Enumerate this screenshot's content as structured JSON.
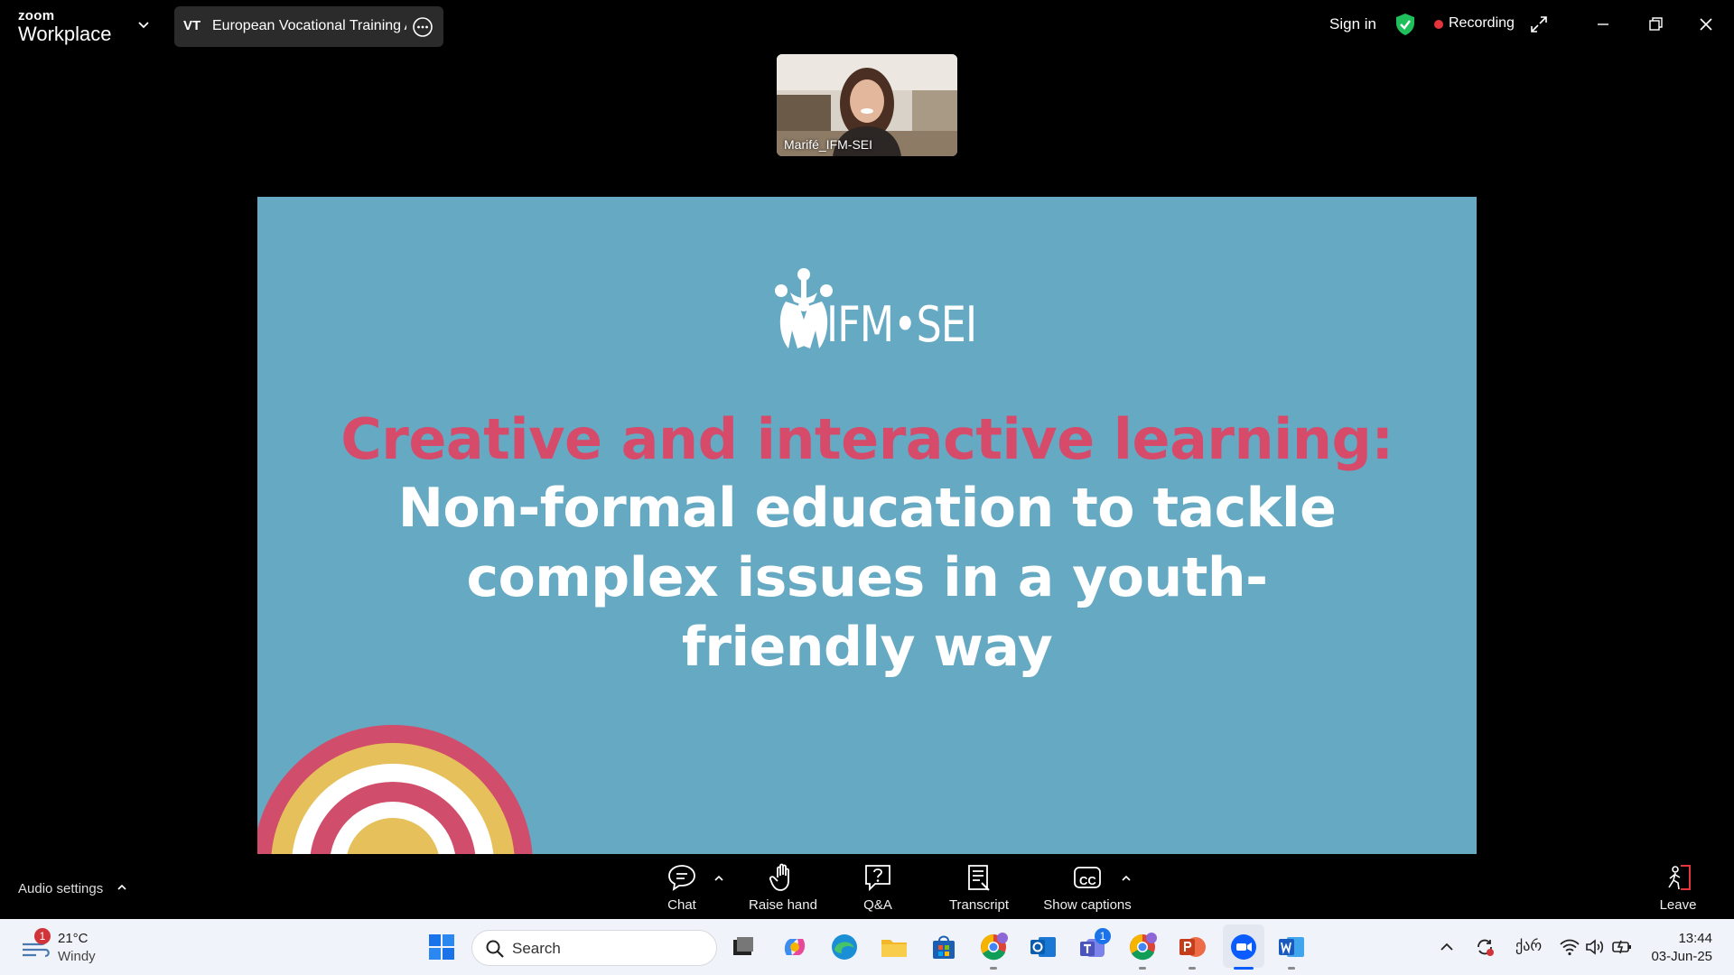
{
  "window": {
    "brand_small": "zoom",
    "brand_big": "Workplace",
    "meeting_icon_text": "VT",
    "meeting_name": "European Vocational Training Ass",
    "sign_in": "Sign in",
    "recording": "Recording"
  },
  "video": {
    "participant_name": "Marifé_IFM-SEI"
  },
  "slide": {
    "logo_text": "IFM•SEI",
    "title_line1": "Creative and interactive learning:",
    "title_line2": "Non-formal education to tackle complex issues in a youth-friendly way",
    "colors": {
      "background": "#66a9c3",
      "accent": "#d64a6a"
    }
  },
  "controls": {
    "audio_settings": "Audio settings",
    "chat": "Chat",
    "raise_hand": "Raise hand",
    "qa": "Q&A",
    "transcript": "Transcript",
    "show_captions": "Show captions",
    "cc_icon_text": "CC",
    "leave": "Leave",
    "leave_color": "#e5343b"
  },
  "taskbar": {
    "weather_badge": "1",
    "temperature": "21°C",
    "condition": "Windy",
    "search_placeholder": "Search",
    "teams_badge": "1",
    "language": "ქარ",
    "time": "13:44",
    "date": "03-Jun-25",
    "apps": [
      "start-icon",
      "task-view-icon",
      "copilot-icon",
      "edge-icon",
      "file-explorer-icon",
      "store-icon",
      "chrome-icon",
      "outlook-icon",
      "teams-icon",
      "chrome-icon",
      "powerpoint-icon",
      "zoom-icon",
      "word-icon"
    ]
  }
}
